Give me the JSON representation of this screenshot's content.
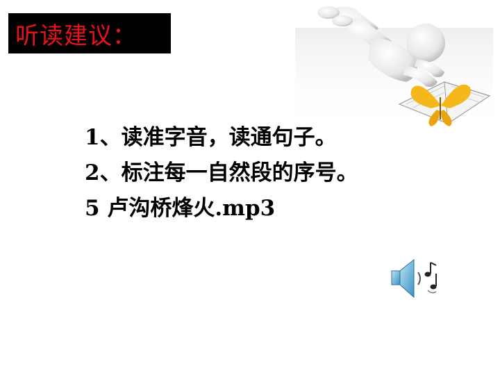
{
  "title": "听读建议：",
  "suggestions": [
    "1、读准字音，读通句子。",
    "2、标注每一自然段的序号。"
  ],
  "audio_link": "5 卢沟桥烽火.mp3",
  "colors": {
    "title_background": "#000000",
    "title_text": "#e8121a",
    "butterfly": "#f5b81c"
  },
  "icons": {
    "illustration": "reading-figure-illustration",
    "audio": "speaker-icon"
  }
}
